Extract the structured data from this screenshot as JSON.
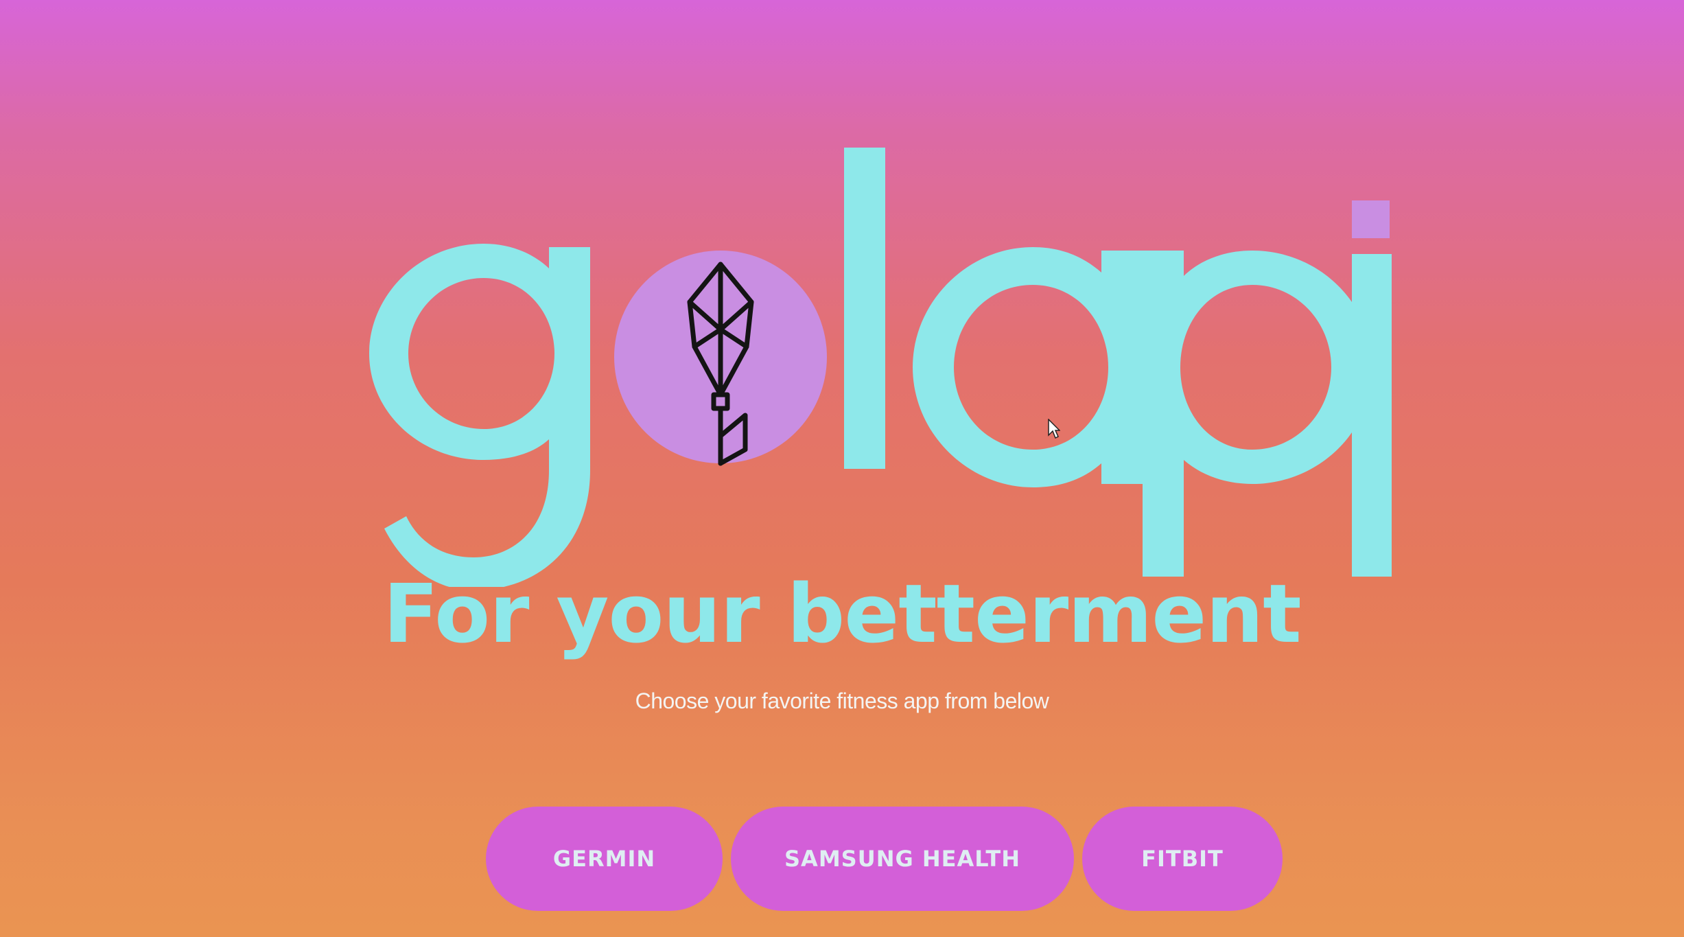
{
  "brand": {
    "logo_text": "golapi",
    "logo_color": "#8ee8ea",
    "logo_circle_color": "#c98ee2",
    "flower_icon": "flower-icon"
  },
  "hero": {
    "tagline": "For your betterment",
    "subtitle": "Choose your favorite fitness app from below"
  },
  "apps": [
    {
      "label": "GERMIN"
    },
    {
      "label": "SAMSUNG HEALTH"
    },
    {
      "label": "FITBIT"
    }
  ],
  "colors": {
    "background_top": "#d765d8",
    "background_bottom": "#ea9452",
    "button_background": "#d35fd8",
    "button_text": "#dfeef2",
    "tagline": "#8ee8ea",
    "subtitle": "#f4f4f2"
  }
}
